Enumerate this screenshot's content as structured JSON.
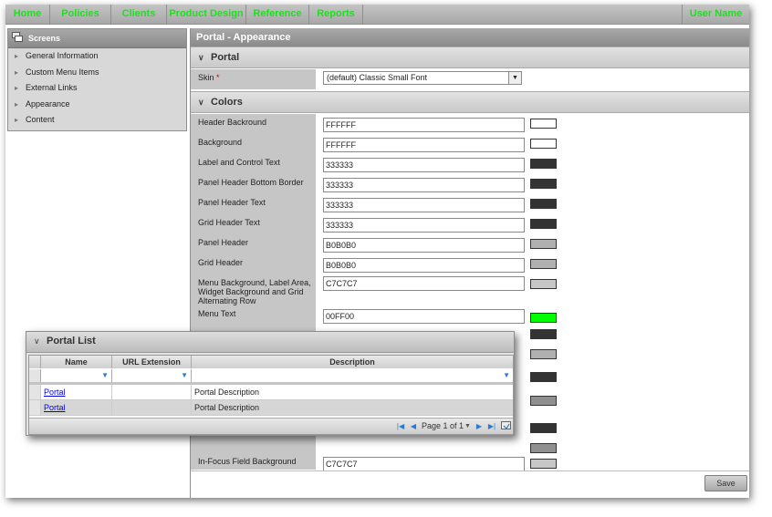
{
  "nav": {
    "items": [
      "Home",
      "Policies",
      "Clients",
      "Product Design",
      "Reference",
      "Reports"
    ],
    "user": "User Name"
  },
  "screens": {
    "title": "Screens",
    "items": [
      "General Information",
      "Custom Menu Items",
      "External Links",
      "Appearance",
      "Content"
    ]
  },
  "main": {
    "title": "Portal - Appearance",
    "portal_section": "Portal",
    "skin_label": "Skin",
    "skin_required": "*",
    "skin_value": "(default) Classic Small Font",
    "colors_section": "Colors",
    "colors": [
      {
        "label": "Header Backround",
        "value": "FFFFFF",
        "swatch": "#FFFFFF"
      },
      {
        "label": "Background",
        "value": "FFFFFF",
        "swatch": "#FFFFFF"
      },
      {
        "label": "Label and Control Text",
        "value": "333333",
        "swatch": "#333333"
      },
      {
        "label": "Panel Header Bottom Border",
        "value": "333333",
        "swatch": "#333333"
      },
      {
        "label": "Panel Header Text",
        "value": "333333",
        "swatch": "#333333"
      },
      {
        "label": "Grid Header Text",
        "value": "333333",
        "swatch": "#333333"
      },
      {
        "label": "Panel Header",
        "value": "B0B0B0",
        "swatch": "#B0B0B0"
      },
      {
        "label": "Grid Header",
        "value": "B0B0B0",
        "swatch": "#B0B0B0"
      },
      {
        "label": "Menu Background, Label Area, Widget Background and Grid Alternating Row",
        "value": "C7C7C7",
        "swatch": "#C7C7C7"
      },
      {
        "label": "Menu Text",
        "value": "00FF00",
        "swatch": "#00FF00"
      },
      {
        "label": "",
        "value": "",
        "swatch": "#333333"
      },
      {
        "label": "",
        "value": "",
        "swatch": "#B0B0B0"
      },
      {
        "label": "",
        "value": "",
        "swatch": "#333333"
      },
      {
        "label": "",
        "value": "",
        "swatch": "#909090"
      },
      {
        "label": "",
        "value": "",
        "swatch": "#333333"
      },
      {
        "label": "",
        "value": "",
        "swatch": "#909090"
      },
      {
        "label": "In-Focus Field Background",
        "value": "C7C7C7",
        "swatch": "#C7C7C7"
      }
    ],
    "save_label": "Save"
  },
  "portal_list": {
    "title": "Portal List",
    "columns": [
      "Name",
      "URL Extension",
      "Description"
    ],
    "rows": [
      {
        "name": "Portal",
        "url": "",
        "description": "Portal Description"
      },
      {
        "name": "Portal",
        "url": "",
        "description": "Portal Description"
      }
    ],
    "pager_text": "Page 1 of 1"
  },
  "icons": {
    "screens": "screens-icon",
    "filter": "funnel-icon",
    "first": "first-page-icon",
    "prev": "prev-page-icon",
    "next": "next-page-icon",
    "last": "last-page-icon",
    "export": "export-icon"
  },
  "colors": {
    "nav_text": "#22DD22",
    "link": "#0000EE",
    "filter_icon": "#2A80D0"
  }
}
